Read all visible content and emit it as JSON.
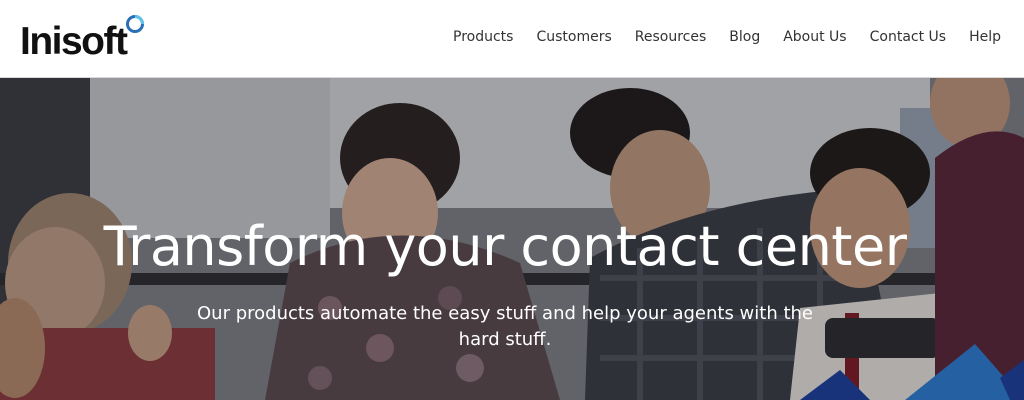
{
  "brand": {
    "name": "Inisoft",
    "ring_color_outer": "#2a6fb5",
    "ring_color_inner": "#5ec3e8"
  },
  "nav": {
    "items": [
      {
        "label": "Products"
      },
      {
        "label": "Customers"
      },
      {
        "label": "Resources"
      },
      {
        "label": "Blog"
      },
      {
        "label": "About Us"
      },
      {
        "label": "Contact Us"
      },
      {
        "label": "Help"
      }
    ]
  },
  "hero": {
    "title": "Transform your contact center",
    "subtitle": "Our products automate the easy stuff and help your agents with the hard stuff.",
    "image": "team-meeting-photo",
    "accent_colors": [
      "#1b3f9e",
      "#2b7fd6"
    ]
  }
}
